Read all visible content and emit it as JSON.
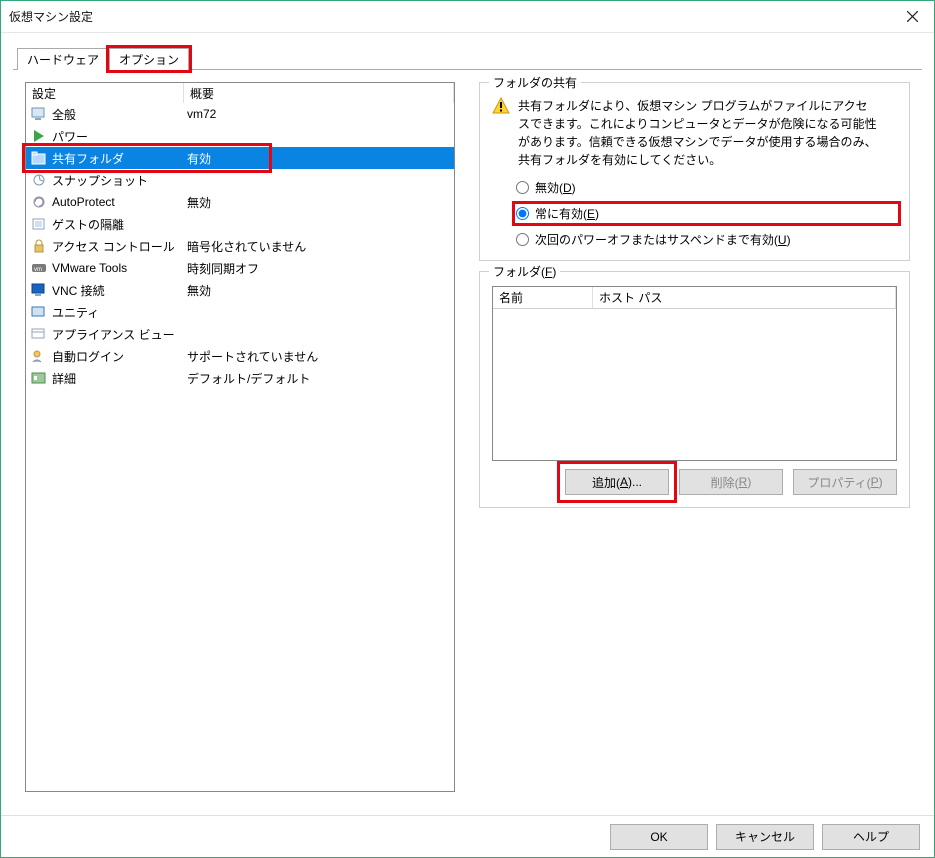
{
  "window": {
    "title": "仮想マシン設定"
  },
  "tabs": {
    "hardware": "ハードウェア",
    "options": "オプション"
  },
  "list": {
    "header_setting": "設定",
    "header_summary": "概要",
    "rows": [
      {
        "name": "全般",
        "summary": "vm72"
      },
      {
        "name": "パワー",
        "summary": ""
      },
      {
        "name": "共有フォルダ",
        "summary": "有効"
      },
      {
        "name": "スナップショット",
        "summary": ""
      },
      {
        "name": "AutoProtect",
        "summary": "無効"
      },
      {
        "name": "ゲストの隔離",
        "summary": ""
      },
      {
        "name": "アクセス コントロール",
        "summary": "暗号化されていません"
      },
      {
        "name": "VMware Tools",
        "summary": "時刻同期オフ"
      },
      {
        "name": "VNC 接続",
        "summary": "無効"
      },
      {
        "name": "ユニティ",
        "summary": ""
      },
      {
        "name": "アプライアンス ビュー",
        "summary": ""
      },
      {
        "name": "自動ログイン",
        "summary": "サポートされていません"
      },
      {
        "name": "詳細",
        "summary": "デフォルト/デフォルト"
      }
    ]
  },
  "right": {
    "share_legend": "フォルダの共有",
    "warning_text": "共有フォルダにより、仮想マシン プログラムがファイルにアクセスできます。これによりコンピュータとデータが危険になる可能性があります。信頼できる仮想マシンでデータが使用する場合のみ、共有フォルダを有効にしてください。",
    "radios": {
      "disabled_pre": "無効(",
      "disabled_u": "D",
      "disabled_post": ")",
      "always_pre": "常に有効(",
      "always_u": "E",
      "always_post": ")",
      "until_pre": "次回のパワーオフまたはサスペンドまで有効(",
      "until_u": "U",
      "until_post": ")"
    },
    "folders_legend_pre": "フォルダ(",
    "folders_legend_u": "F",
    "folders_legend_post": ")",
    "col_name": "名前",
    "col_host": "ホスト パス",
    "btn_add_pre": "追加(",
    "btn_add_u": "A",
    "btn_add_post": ")...",
    "btn_remove_pre": "削除(",
    "btn_remove_u": "R",
    "btn_remove_post": ")",
    "btn_props_pre": "プロパティ(",
    "btn_props_u": "P",
    "btn_props_post": ")"
  },
  "footer": {
    "ok": "OK",
    "cancel": "キャンセル",
    "help": "ヘルプ"
  }
}
